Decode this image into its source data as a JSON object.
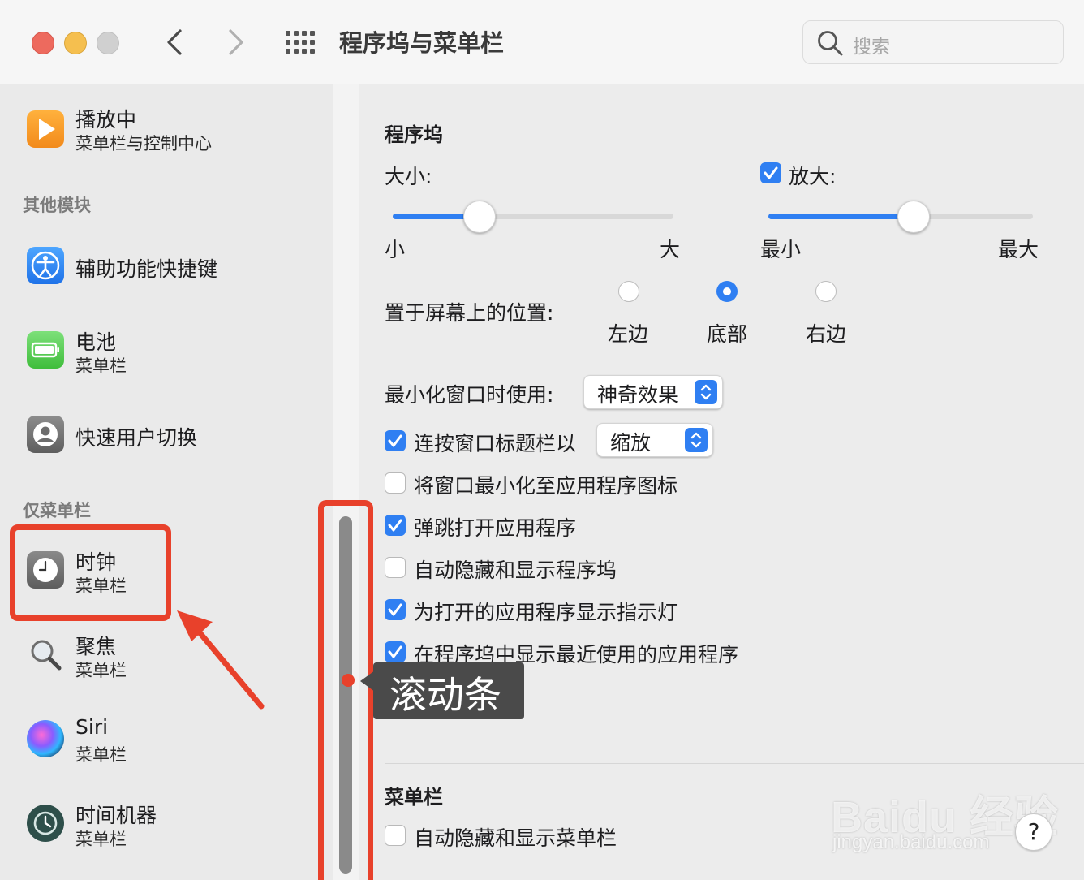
{
  "window": {
    "title": "程序坞与菜单栏"
  },
  "search": {
    "placeholder": "搜索"
  },
  "sidebar": {
    "now_playing": {
      "title": "播放中",
      "subtitle": "菜单栏与控制中心"
    },
    "section_other": "其他模块",
    "accessibility": {
      "title": "辅助功能快捷键"
    },
    "battery": {
      "title": "电池",
      "subtitle": "菜单栏"
    },
    "fast_user": {
      "title": "快速用户切换"
    },
    "section_menubar_only": "仅菜单栏",
    "clock": {
      "title": "时钟",
      "subtitle": "菜单栏"
    },
    "spotlight": {
      "title": "聚焦",
      "subtitle": "菜单栏"
    },
    "siri": {
      "title": "Siri",
      "subtitle": "菜单栏"
    },
    "time_machine": {
      "title": "时间机器",
      "subtitle": "菜单栏"
    }
  },
  "dock": {
    "section_title": "程序坞",
    "size": {
      "label": "大小:",
      "min_label": "小",
      "max_label": "大",
      "value": 0.31
    },
    "magnification": {
      "label": "放大:",
      "checked": true,
      "min_label": "最小",
      "max_label": "最大",
      "value": 0.55
    },
    "position": {
      "label": "置于屏幕上的位置:",
      "options": [
        "左边",
        "底部",
        "右边"
      ],
      "selected": "底部"
    },
    "minimize_effect": {
      "label": "最小化窗口时使用:",
      "value": "神奇效果"
    },
    "double_click": {
      "label": "连按窗口标题栏以",
      "value": "缩放",
      "checked": true
    },
    "options": [
      {
        "label": "将窗口最小化至应用程序图标",
        "checked": false
      },
      {
        "label": "弹跳打开应用程序",
        "checked": true
      },
      {
        "label": "自动隐藏和显示程序坞",
        "checked": false
      },
      {
        "label": "为打开的应用程序显示指示灯",
        "checked": true
      },
      {
        "label": "在程序坞中显示最近使用的应用程序",
        "checked": true
      }
    ]
  },
  "menubar": {
    "section_title": "菜单栏",
    "auto_hide": {
      "label": "自动隐藏和显示菜单栏",
      "checked": false
    }
  },
  "annotation": {
    "tooltip": "滚动条"
  },
  "help": {
    "label": "?"
  },
  "watermark": {
    "brand": "Baidu 经验",
    "url": "jingyan.baidu.com"
  },
  "colors": {
    "accent": "#2f7ff2",
    "annotation_red": "#e8412b"
  }
}
